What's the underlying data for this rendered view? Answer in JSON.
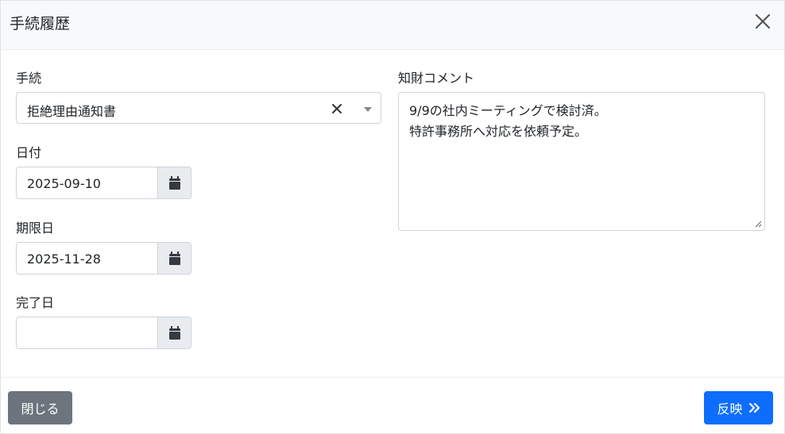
{
  "header": {
    "title": "手続履歴"
  },
  "procedure": {
    "label": "手続",
    "value": "拒絶理由通知書"
  },
  "date": {
    "label": "日付",
    "value": "2025-09-10"
  },
  "deadline": {
    "label": "期限日",
    "value": "2025-11-28"
  },
  "completed": {
    "label": "完了日",
    "value": ""
  },
  "comment": {
    "label": "知財コメント",
    "lines": [
      "9/9の社内ミーティングで検討済。",
      "特許事務所へ対応を依頼予定。"
    ]
  },
  "footer": {
    "close_label": "閉じる",
    "apply_label": "反映"
  },
  "colors": {
    "primary": "#0d6efd",
    "secondary": "#6c757d",
    "header_bg": "#f8f9fa"
  }
}
